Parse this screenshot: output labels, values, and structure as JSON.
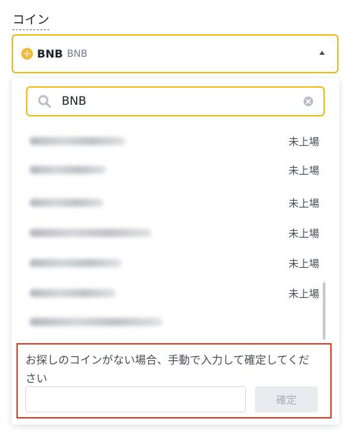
{
  "field": {
    "label": "コイン"
  },
  "coin_select": {
    "symbol": "BNB",
    "name": "BNB",
    "logo_color": "#f3ba2f",
    "caret_icon": "caret-up-icon"
  },
  "search": {
    "value": "BNB",
    "search_icon": "search-icon",
    "clear_icon": "clear-icon"
  },
  "results": [
    {
      "status": "未上場"
    },
    {
      "status": "未上場"
    },
    {
      "status": "未上場"
    },
    {
      "status": "未上場"
    },
    {
      "status": "未上場"
    },
    {
      "status": "未上場"
    },
    {
      "status": ""
    }
  ],
  "manual_entry": {
    "prompt": "お探しのコインがない場合、手動で入力して確定してください",
    "input_value": "",
    "confirm_label": "確定"
  },
  "colors": {
    "accent": "#f0b90b",
    "highlight": "#e4371e"
  }
}
